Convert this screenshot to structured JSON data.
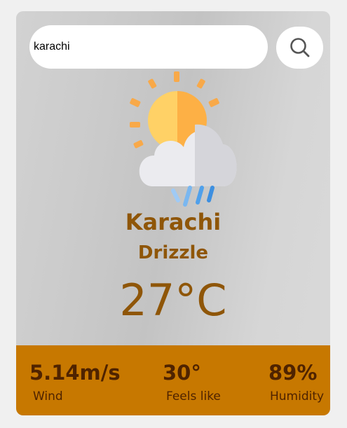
{
  "search": {
    "value": "karachi",
    "button_icon": "search-icon"
  },
  "weather": {
    "icon": "sun-cloud-rain-icon",
    "city": "Karachi",
    "condition": "Drizzle",
    "temperature": "27°C"
  },
  "stats": {
    "wind": {
      "value": "5.14m/s",
      "label": "Wind"
    },
    "feels_like": {
      "value": "30°",
      "label": "Feels like"
    },
    "humidity": {
      "value": "89%",
      "label": "Humidity"
    }
  },
  "colors": {
    "page_background": "#f0f0f0",
    "card_background": "#cbcbcb",
    "text_brown": "#8f5608",
    "stats_bar": "#c77800",
    "stats_text": "#4f2300"
  }
}
